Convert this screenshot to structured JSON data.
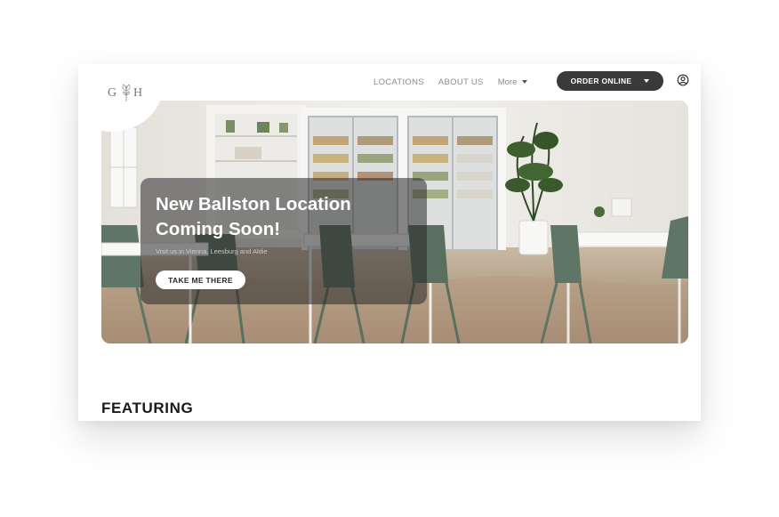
{
  "logo": {
    "letter_left": "G",
    "letter_right": "H",
    "tagline": "· · ·"
  },
  "nav": {
    "items": [
      "LOCATIONS",
      "ABOUT US"
    ],
    "more_label": "More"
  },
  "order_button": {
    "label": "ORDER ONLINE"
  },
  "icons": {
    "account": "user-circle-icon",
    "dropdown": "caret-down-icon"
  },
  "hero": {
    "title_line1": "New Ballston Location",
    "title_line2": "Coming Soon!",
    "subtitle": "Visit us in Vienna, Leesburg and Aldie",
    "button_label": "TAKE ME THERE"
  },
  "featuring": {
    "heading": "FEATURING"
  },
  "colors": {
    "dark_button": "#3a3a3a",
    "overlay": "#282828",
    "text_white": "#ffffff"
  }
}
